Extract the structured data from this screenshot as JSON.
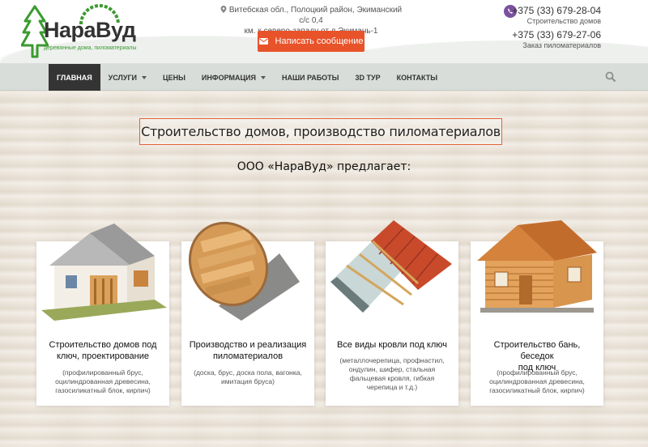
{
  "logo": {
    "name": "НараВуд",
    "tagline": "деревянные дома, пиломатериалы"
  },
  "header": {
    "address_line1": "Витебская обл., Полоцкий район, Экиманский с/с 0,4",
    "address_line2": "км. к северо-западу от д.Экимань-1",
    "message_button": "Написать сообщение",
    "phone1": "+375 (33) 679-28-04",
    "phone1_note": "Строительство домов",
    "phone2": "+375 (33) 679-27-06",
    "phone2_note": "Заказ пиломатериалов"
  },
  "nav": {
    "items": [
      {
        "label": "ГЛАВНАЯ",
        "active": true,
        "dropdown": false
      },
      {
        "label": "УСЛУГИ",
        "active": false,
        "dropdown": true
      },
      {
        "label": "ЦЕНЫ",
        "active": false,
        "dropdown": false
      },
      {
        "label": "ИНФОРМАЦИЯ",
        "active": false,
        "dropdown": true
      },
      {
        "label": "НАШИ РАБОТЫ",
        "active": false,
        "dropdown": false
      },
      {
        "label": "3D ТУР",
        "active": false,
        "dropdown": false
      },
      {
        "label": "КОНТАКТЫ",
        "active": false,
        "dropdown": false
      }
    ]
  },
  "main": {
    "title": "Строительство домов, производство пиломатериалов",
    "subtitle": "ООО «НараВуд» предлагает:",
    "cards": [
      {
        "title_line1": "Строительство домов под",
        "title_line2": "ключ, проектирование",
        "desc_line1": "(профилированный брус,",
        "desc_line2": "оцилиндрованная древесина,",
        "desc_line3": "газосиликатный блок, кирпич)",
        "desc_line4": ""
      },
      {
        "title_line1": "Производство и реализация",
        "title_line2": "пиломатериалов",
        "desc_line1": "(доска, брус, доска пола, вагонка,",
        "desc_line2": "имитация бруса)",
        "desc_line3": "",
        "desc_line4": ""
      },
      {
        "title_line1": "Все виды кровли под ключ",
        "title_line2": "",
        "desc_line1": "(металлочерепица, профнастил,",
        "desc_line2": "ондулин, шифер, стальная",
        "desc_line3": "фальцевая кровля, гибкая",
        "desc_line4": "черепица и т.д.)"
      },
      {
        "title_line1": "Строительство бань, беседок",
        "title_line2": "под ключ",
        "desc_line1": "(профилированный брус,",
        "desc_line2": "оцилиндрованная древесина,",
        "desc_line3": "газосиликатный блок, кирпич)",
        "desc_line4": ""
      }
    ]
  },
  "icons": {
    "pin": "map-pin-icon",
    "envelope": "envelope-icon",
    "viber": "viber-icon",
    "search": "search-icon"
  },
  "colors": {
    "accent": "#e8532a",
    "logo_green": "#3b9b2f",
    "nav_active": "#343434",
    "nav_bg": "#d8ddd9"
  }
}
